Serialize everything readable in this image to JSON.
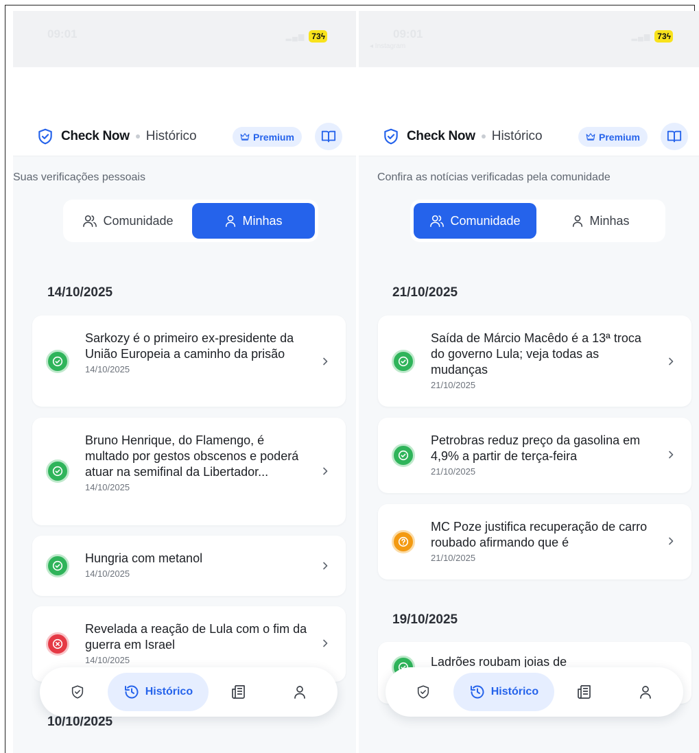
{
  "screens": [
    {
      "status": {
        "time": "09:01",
        "sub": "",
        "battery": "73"
      },
      "header": {
        "brand": "Check Now",
        "page": "Histórico",
        "premium": "Premium"
      },
      "subtitle": "Suas verificações pessoais",
      "tabs": {
        "community": "Comunidade",
        "mine": "Minhas",
        "active": "mine"
      },
      "sections": [
        {
          "date": "14/10/2025",
          "items": [
            {
              "title": "Sarkozy é o primeiro ex-presidente da União Europeia a caminho da prisão",
              "date": "14/10/2025",
              "status": "verified"
            },
            {
              "title": "Bruno Henrique, do Flamengo, é multado por gestos obscenos e poderá atuar na semifinal da Libertador...",
              "date": "14/10/2025",
              "status": "verified"
            },
            {
              "title": "Hungria com metanol",
              "date": "14/10/2025",
              "status": "verified"
            },
            {
              "title": "Revelada a reação de Lula com o fim da guerra em Israel",
              "date": "14/10/2025",
              "status": "false"
            }
          ]
        },
        {
          "date": "10/10/2025",
          "items": []
        }
      ],
      "nav": {
        "active_label": "Histórico"
      }
    },
    {
      "status": {
        "time": "09:01",
        "sub": "◂ Instagram",
        "battery": "73"
      },
      "header": {
        "brand": "Check Now",
        "page": "Histórico",
        "premium": "Premium"
      },
      "subtitle": "Confira as notícias verificadas pela comunidade",
      "tabs": {
        "community": "Comunidade",
        "mine": "Minhas",
        "active": "community"
      },
      "sections": [
        {
          "date": "21/10/2025",
          "items": [
            {
              "title": "Saída de Márcio Macêdo é a 13ª troca do governo Lula; veja todas as mudanças",
              "date": "21/10/2025",
              "status": "verified"
            },
            {
              "title": "Petrobras reduz preço da gasolina em 4,9% a partir de terça-feira",
              "date": "21/10/2025",
              "status": "verified"
            },
            {
              "title": "MC Poze justifica recuperação de carro roubado afirmando que é",
              "date": "21/10/2025",
              "status": "unverified"
            }
          ]
        },
        {
          "date": "19/10/2025",
          "items": [
            {
              "title": "Ladrões roubam joias de",
              "date": "",
              "status": "verified"
            }
          ]
        }
      ],
      "nav": {
        "active_label": "Histórico"
      }
    }
  ],
  "colors": {
    "accent": "#2563eb",
    "verified": "#2fb45a",
    "false": "#e53945",
    "unverified": "#f39a12",
    "battery": "#f8e21c"
  },
  "icons": {
    "brand": "shield-check-icon",
    "premium": "crown-icon",
    "guide": "book-open-icon",
    "community": "users-icon",
    "mine": "user-icon",
    "verified": "check-circle-icon",
    "false": "x-circle-icon",
    "unverified": "question-icon",
    "chevron": "chevron-right-icon",
    "nav": [
      "shield-check-icon",
      "history-icon",
      "newspaper-icon",
      "user-icon"
    ]
  }
}
